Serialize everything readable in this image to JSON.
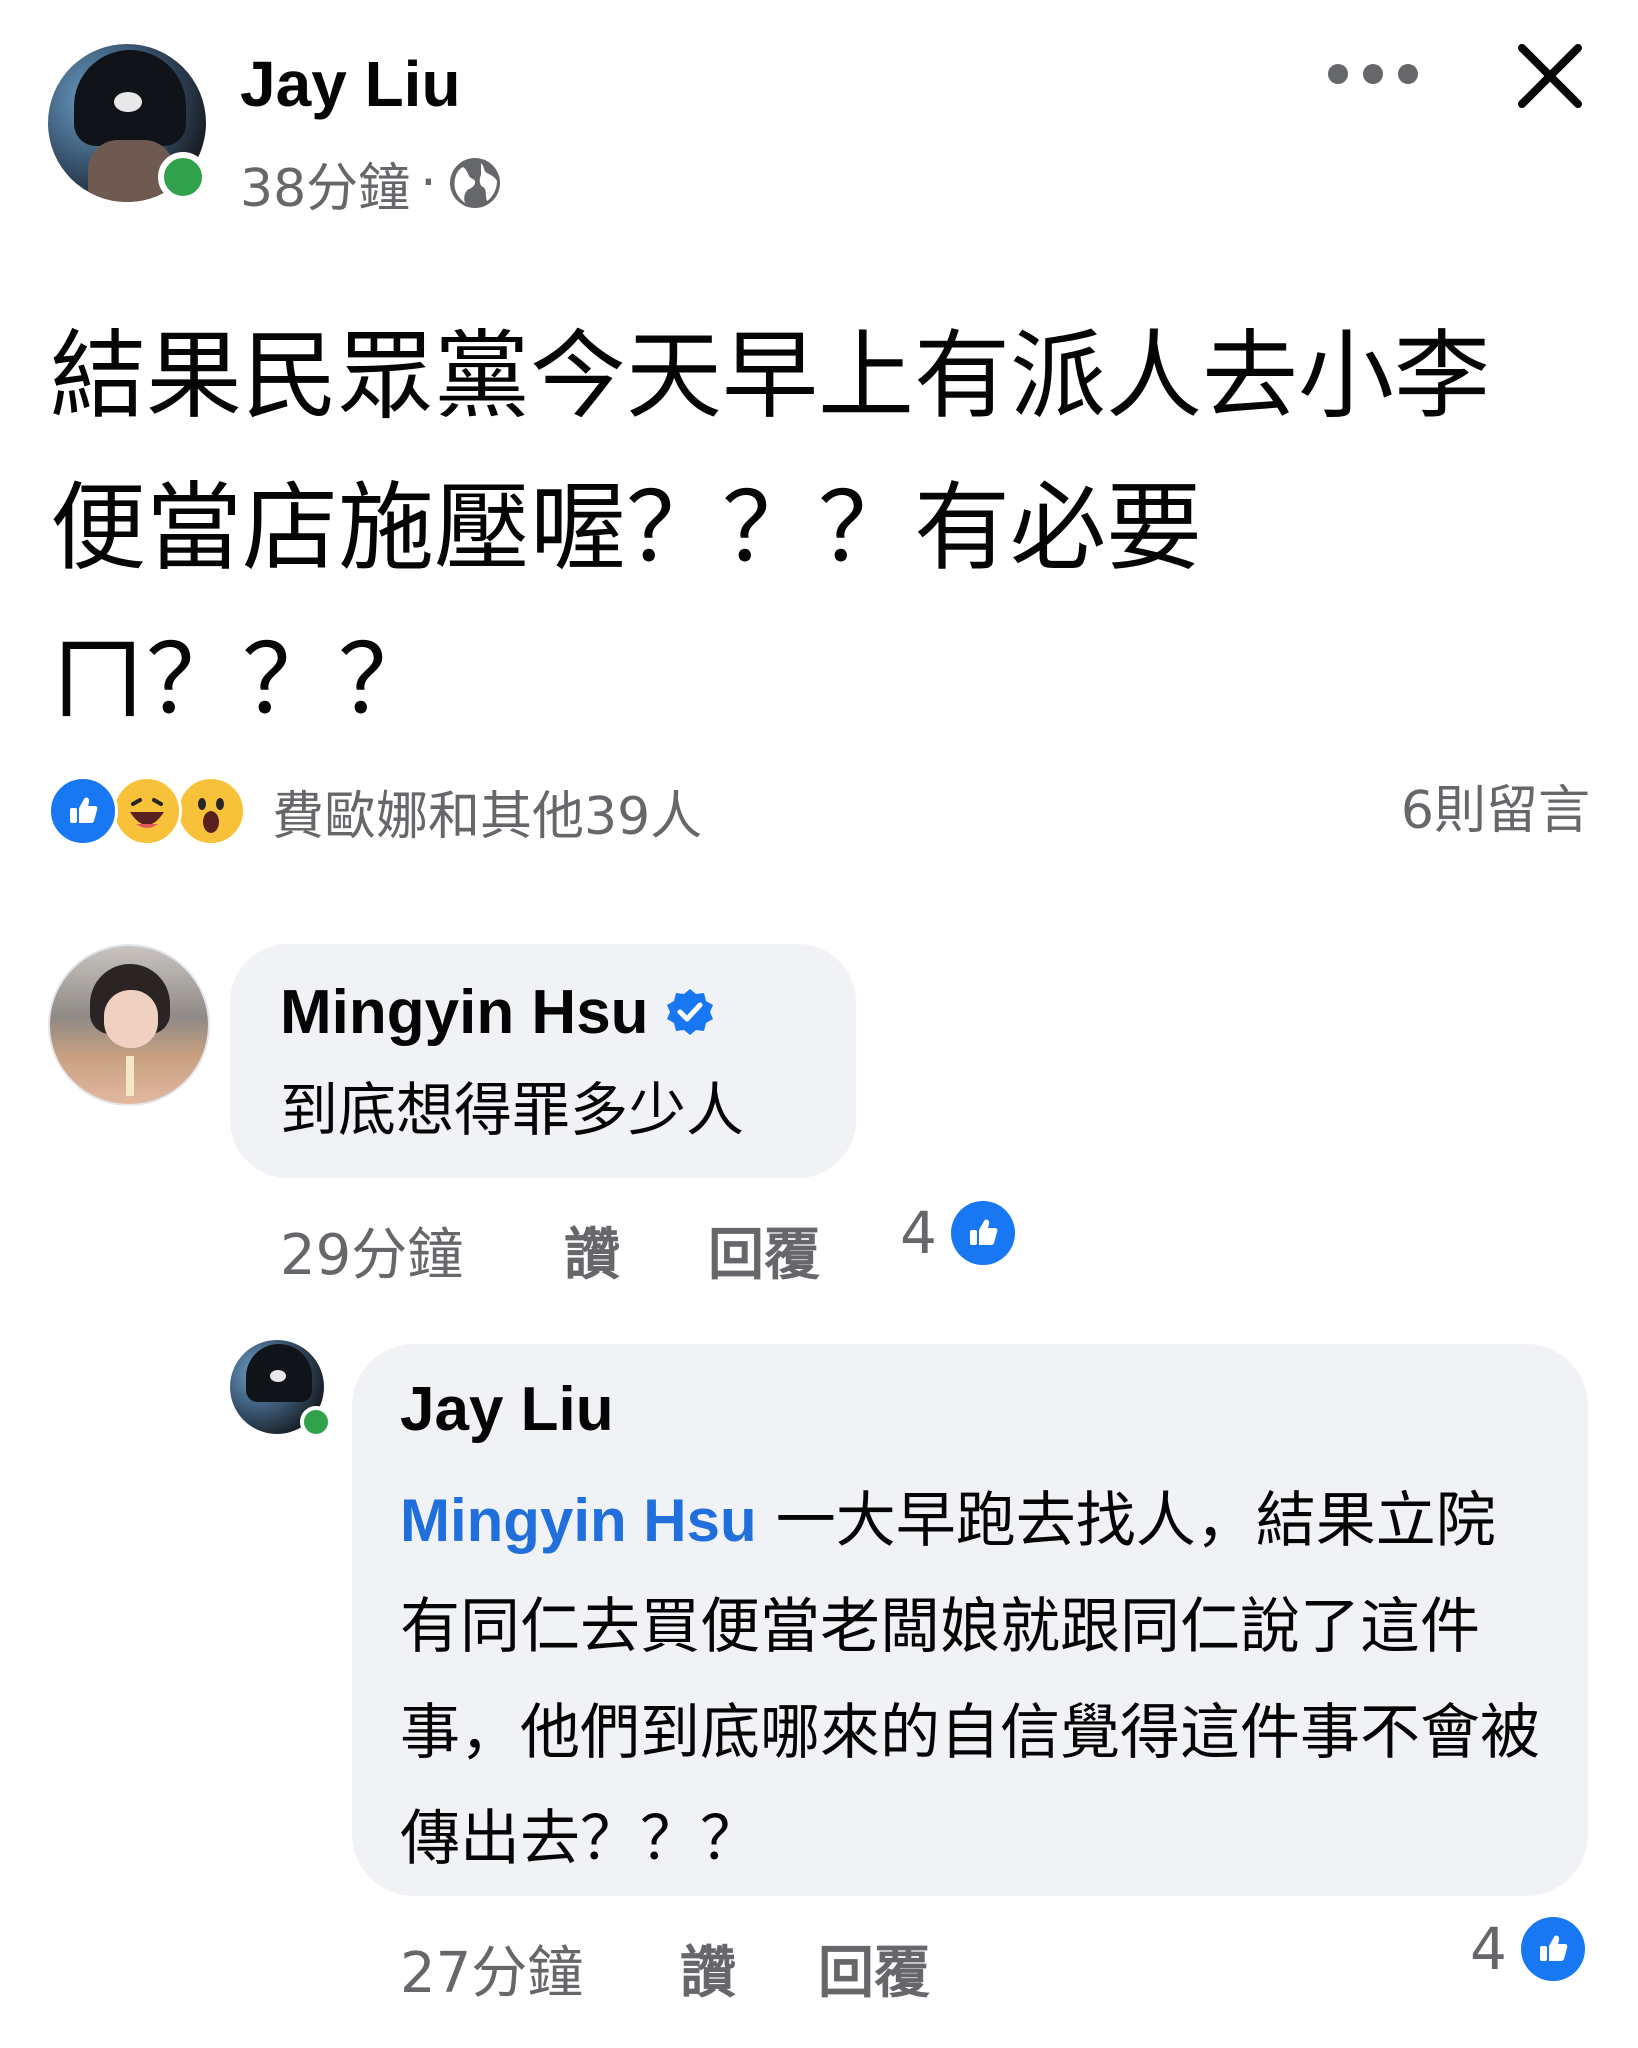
{
  "post": {
    "author": "Jay Liu",
    "time": "38分鐘",
    "separator": "·",
    "text": "結果民眾黨今天早上有派人去小李\n便當店施壓喔？？？有必要\nㄇ？？？",
    "reactions_text": "費歐娜和其他39人",
    "comments_count": "6則留言"
  },
  "comments": [
    {
      "author": "Mingyin Hsu",
      "verified": true,
      "text": "到底想得罪多少人",
      "time": "29分鐘",
      "like_label": "讚",
      "reply_label": "回覆",
      "like_count": "4"
    },
    {
      "author": "Jay Liu",
      "mention": "Mingyin Hsu",
      "text": " 一大早跑去找人，結果立院有同仁去買便當老闆娘就跟同仁說了這件事，他們到底哪來的自信覺得這件事不會被傳出去？？？",
      "time": "27分鐘",
      "like_label": "讚",
      "reply_label": "回覆",
      "like_count": "4"
    }
  ],
  "colors": {
    "accent": "#1877f2",
    "mention": "#216fdb",
    "online": "#31a24c",
    "secondary_text": "#65676b",
    "bubble": "#f0f2f5"
  },
  "icons": {
    "more": "more-horizontal-icon",
    "close": "close-icon",
    "audience": "globe-icon",
    "verified": "verified-badge-icon",
    "like": "thumbs-up-icon"
  }
}
